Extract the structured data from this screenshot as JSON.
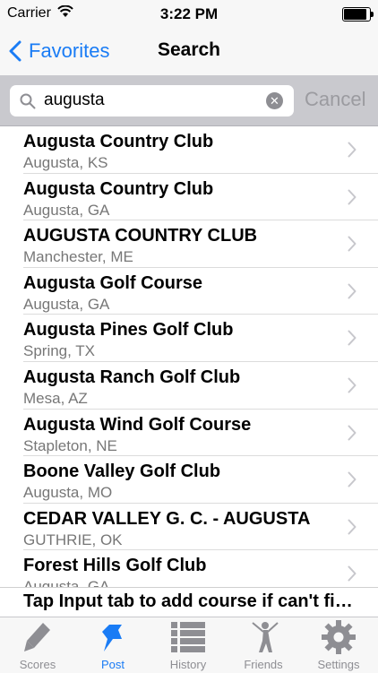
{
  "status_bar": {
    "carrier": "Carrier",
    "time": "3:22 PM",
    "battery_level": 0.95
  },
  "nav": {
    "back_label": "Favorites",
    "title": "Search"
  },
  "search": {
    "value": "augusta",
    "cancel_label": "Cancel"
  },
  "results": [
    {
      "name": "Augusta Country Club",
      "location": "Augusta, KS"
    },
    {
      "name": "Augusta Country Club",
      "location": "Augusta, GA"
    },
    {
      "name": "AUGUSTA COUNTRY CLUB",
      "location": "Manchester, ME"
    },
    {
      "name": "Augusta Golf Course",
      "location": "Augusta, GA"
    },
    {
      "name": "Augusta Pines Golf Club",
      "location": "Spring, TX"
    },
    {
      "name": "Augusta Ranch Golf Club",
      "location": "Mesa, AZ"
    },
    {
      "name": "Augusta Wind Golf Course",
      "location": "Stapleton, NE"
    },
    {
      "name": "Boone Valley Golf Club",
      "location": "Augusta, MO"
    },
    {
      "name": "CEDAR VALLEY G. C. - AUGUSTA",
      "location": "GUTHRIE, OK"
    },
    {
      "name": "Forest Hills Golf Club",
      "location": "Augusta, GA"
    }
  ],
  "footer_message": "Tap Input tab to add course if can't find it",
  "tabs": [
    {
      "label": "Scores",
      "icon": "pencil-icon"
    },
    {
      "label": "Post",
      "icon": "pushpin-icon"
    },
    {
      "label": "History",
      "icon": "list-icon"
    },
    {
      "label": "Friends",
      "icon": "golfer-icon"
    },
    {
      "label": "Settings",
      "icon": "gear-icon"
    }
  ],
  "colors": {
    "accent": "#1a7cf5",
    "inactive": "#8e8e93"
  }
}
